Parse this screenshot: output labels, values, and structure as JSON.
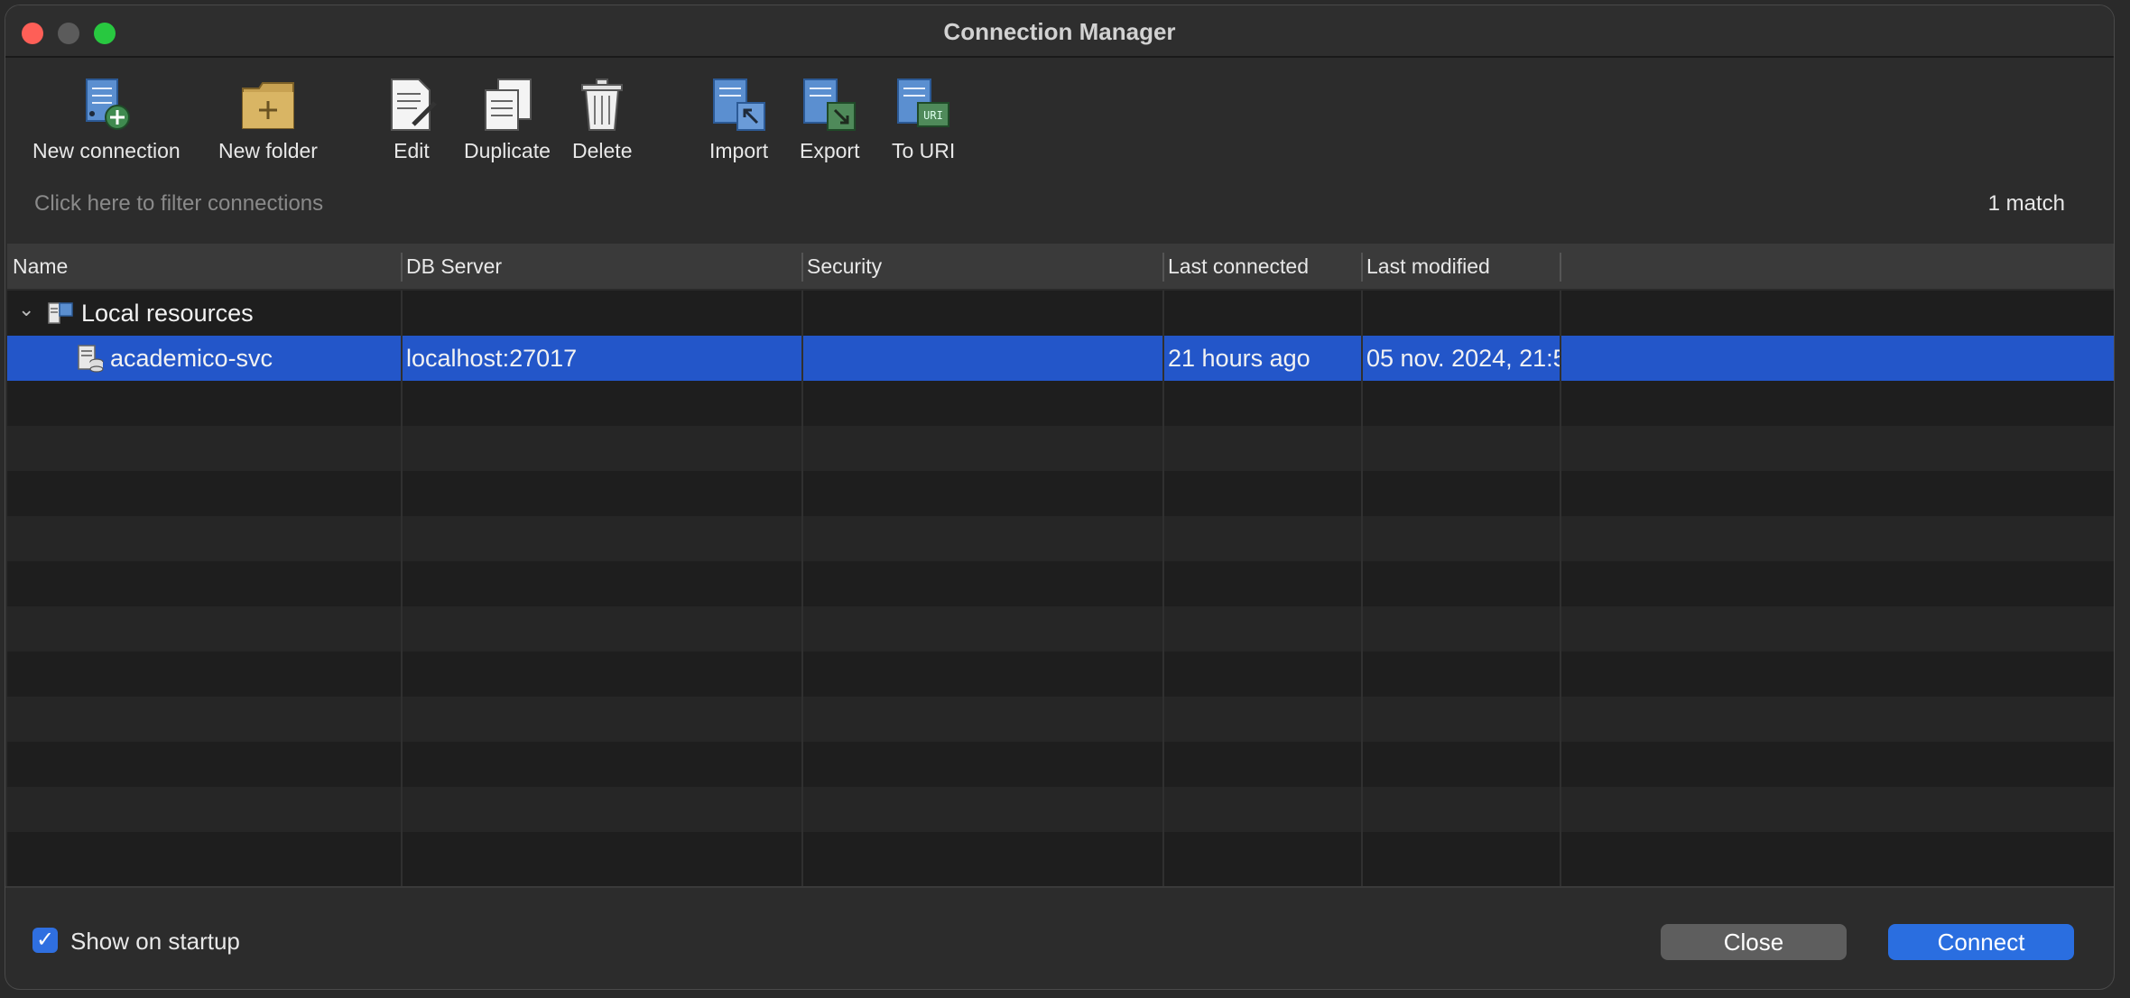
{
  "window": {
    "title": "Connection Manager"
  },
  "toolbar": {
    "new_connection": "New connection",
    "new_folder": "New folder",
    "edit": "Edit",
    "duplicate": "Duplicate",
    "delete": "Delete",
    "import": "Import",
    "export": "Export",
    "to_uri": "To URI",
    "uri_badge": "URI"
  },
  "filter": {
    "placeholder": "Click here to filter connections",
    "match_count": "1 match"
  },
  "table": {
    "columns": [
      "Name",
      "DB Server",
      "Security",
      "Last connected",
      "Last modified"
    ],
    "group": {
      "label": "Local resources"
    },
    "rows": [
      {
        "name": "academico-svc",
        "server": "localhost:27017",
        "security": "",
        "last_connected": "21 hours ago",
        "last_modified": "05 nov. 2024, 21:5"
      }
    ]
  },
  "footer": {
    "show_on_startup": "Show on startup",
    "checked": true,
    "close": "Close",
    "connect": "Connect"
  },
  "colors": {
    "selection": "#2356c9",
    "accent": "#2a6ee0"
  }
}
